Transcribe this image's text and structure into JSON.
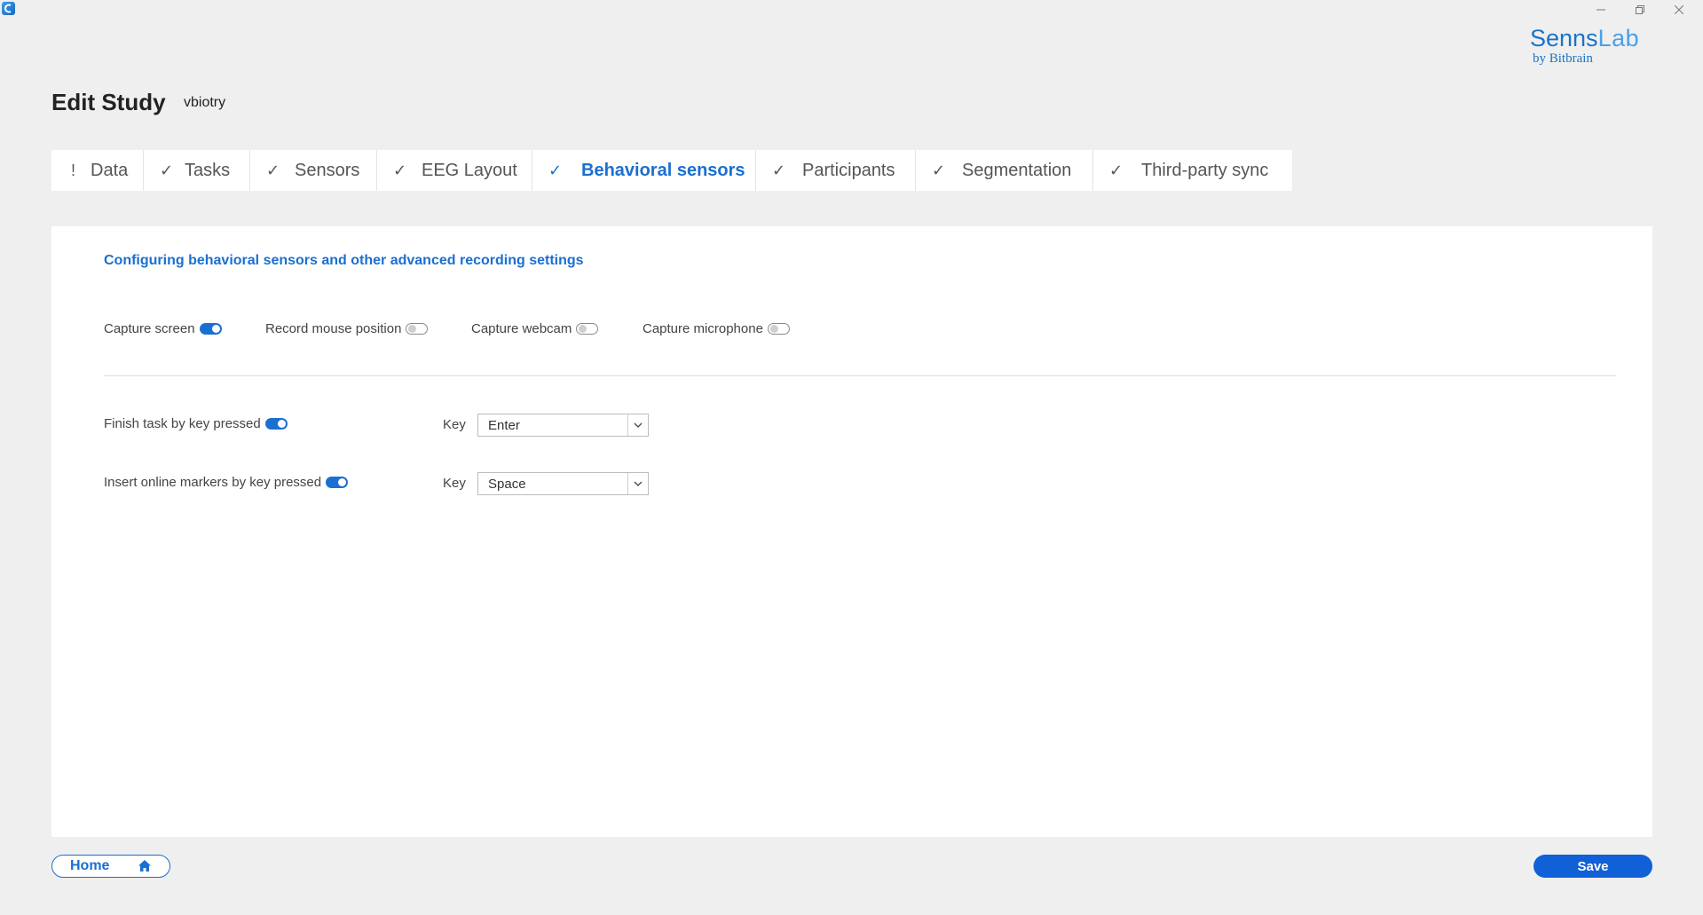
{
  "window": {
    "controls": {
      "minimize_icon": "minimize-icon",
      "maximize_icon": "restore-icon",
      "close_icon": "close-icon"
    }
  },
  "logo": {
    "brand_senns": "Senns",
    "brand_lab": "Lab",
    "tagline": "by Bitbrain"
  },
  "header": {
    "title": "Edit Study",
    "study_name": "vbiotry"
  },
  "tabs": [
    {
      "mark": "!",
      "label": "Data",
      "active": false
    },
    {
      "mark": "✓",
      "label": "Tasks",
      "active": false
    },
    {
      "mark": "✓",
      "label": "Sensors",
      "active": false
    },
    {
      "mark": "✓",
      "label": "EEG Layout",
      "active": false
    },
    {
      "mark": "✓",
      "label": "Behavioral sensors",
      "active": true
    },
    {
      "mark": "✓",
      "label": "Participants",
      "active": false
    },
    {
      "mark": "✓",
      "label": "Segmentation",
      "active": false
    },
    {
      "mark": "✓",
      "label": "Third-party sync",
      "active": false
    }
  ],
  "panel": {
    "section_title": "Configuring behavioral sensors and other advanced recording settings",
    "capture_toggles": [
      {
        "label": "Capture screen",
        "on": true
      },
      {
        "label": "Record mouse position",
        "on": false
      },
      {
        "label": "Capture webcam",
        "on": false
      },
      {
        "label": "Capture microphone",
        "on": false
      }
    ],
    "key_settings": [
      {
        "label": "Finish task by key pressed",
        "on": true,
        "key_label": "Key",
        "key_value": "Enter"
      },
      {
        "label": "Insert online markers by key pressed",
        "on": true,
        "key_label": "Key",
        "key_value": "Space"
      }
    ]
  },
  "footer": {
    "home_label": "Home",
    "home_icon": "home-icon",
    "save_label": "Save"
  },
  "colors": {
    "accent": "#1a6fd1",
    "save_button": "#1060d8",
    "background": "#efefef",
    "panel": "#ffffff"
  }
}
